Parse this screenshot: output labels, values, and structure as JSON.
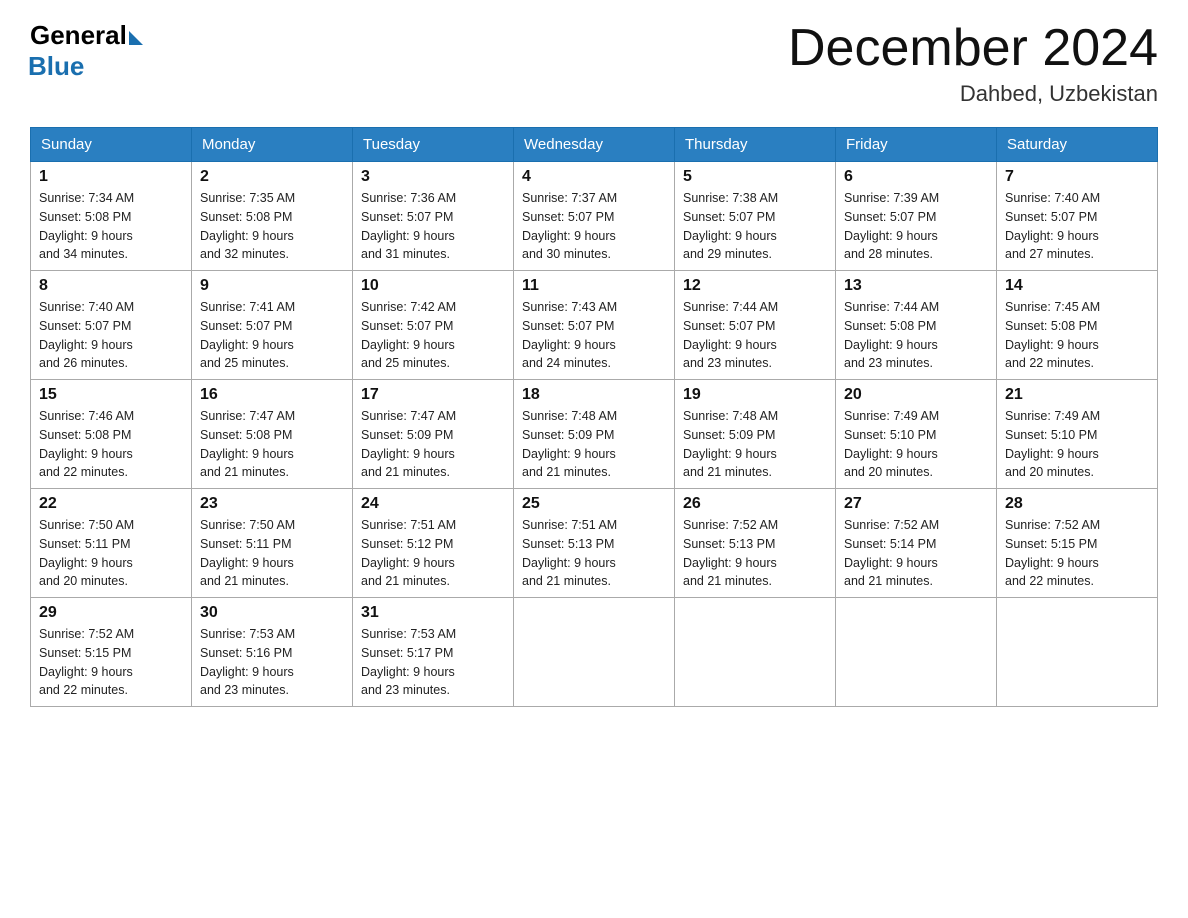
{
  "header": {
    "logo_general": "General",
    "logo_blue": "Blue",
    "month_title": "December 2024",
    "location": "Dahbed, Uzbekistan"
  },
  "columns": [
    "Sunday",
    "Monday",
    "Tuesday",
    "Wednesday",
    "Thursday",
    "Friday",
    "Saturday"
  ],
  "weeks": [
    [
      {
        "day": "1",
        "sunrise": "7:34 AM",
        "sunset": "5:08 PM",
        "daylight": "9 hours and 34 minutes."
      },
      {
        "day": "2",
        "sunrise": "7:35 AM",
        "sunset": "5:08 PM",
        "daylight": "9 hours and 32 minutes."
      },
      {
        "day": "3",
        "sunrise": "7:36 AM",
        "sunset": "5:07 PM",
        "daylight": "9 hours and 31 minutes."
      },
      {
        "day": "4",
        "sunrise": "7:37 AM",
        "sunset": "5:07 PM",
        "daylight": "9 hours and 30 minutes."
      },
      {
        "day": "5",
        "sunrise": "7:38 AM",
        "sunset": "5:07 PM",
        "daylight": "9 hours and 29 minutes."
      },
      {
        "day": "6",
        "sunrise": "7:39 AM",
        "sunset": "5:07 PM",
        "daylight": "9 hours and 28 minutes."
      },
      {
        "day": "7",
        "sunrise": "7:40 AM",
        "sunset": "5:07 PM",
        "daylight": "9 hours and 27 minutes."
      }
    ],
    [
      {
        "day": "8",
        "sunrise": "7:40 AM",
        "sunset": "5:07 PM",
        "daylight": "9 hours and 26 minutes."
      },
      {
        "day": "9",
        "sunrise": "7:41 AM",
        "sunset": "5:07 PM",
        "daylight": "9 hours and 25 minutes."
      },
      {
        "day": "10",
        "sunrise": "7:42 AM",
        "sunset": "5:07 PM",
        "daylight": "9 hours and 25 minutes."
      },
      {
        "day": "11",
        "sunrise": "7:43 AM",
        "sunset": "5:07 PM",
        "daylight": "9 hours and 24 minutes."
      },
      {
        "day": "12",
        "sunrise": "7:44 AM",
        "sunset": "5:07 PM",
        "daylight": "9 hours and 23 minutes."
      },
      {
        "day": "13",
        "sunrise": "7:44 AM",
        "sunset": "5:08 PM",
        "daylight": "9 hours and 23 minutes."
      },
      {
        "day": "14",
        "sunrise": "7:45 AM",
        "sunset": "5:08 PM",
        "daylight": "9 hours and 22 minutes."
      }
    ],
    [
      {
        "day": "15",
        "sunrise": "7:46 AM",
        "sunset": "5:08 PM",
        "daylight": "9 hours and 22 minutes."
      },
      {
        "day": "16",
        "sunrise": "7:47 AM",
        "sunset": "5:08 PM",
        "daylight": "9 hours and 21 minutes."
      },
      {
        "day": "17",
        "sunrise": "7:47 AM",
        "sunset": "5:09 PM",
        "daylight": "9 hours and 21 minutes."
      },
      {
        "day": "18",
        "sunrise": "7:48 AM",
        "sunset": "5:09 PM",
        "daylight": "9 hours and 21 minutes."
      },
      {
        "day": "19",
        "sunrise": "7:48 AM",
        "sunset": "5:09 PM",
        "daylight": "9 hours and 21 minutes."
      },
      {
        "day": "20",
        "sunrise": "7:49 AM",
        "sunset": "5:10 PM",
        "daylight": "9 hours and 20 minutes."
      },
      {
        "day": "21",
        "sunrise": "7:49 AM",
        "sunset": "5:10 PM",
        "daylight": "9 hours and 20 minutes."
      }
    ],
    [
      {
        "day": "22",
        "sunrise": "7:50 AM",
        "sunset": "5:11 PM",
        "daylight": "9 hours and 20 minutes."
      },
      {
        "day": "23",
        "sunrise": "7:50 AM",
        "sunset": "5:11 PM",
        "daylight": "9 hours and 21 minutes."
      },
      {
        "day": "24",
        "sunrise": "7:51 AM",
        "sunset": "5:12 PM",
        "daylight": "9 hours and 21 minutes."
      },
      {
        "day": "25",
        "sunrise": "7:51 AM",
        "sunset": "5:13 PM",
        "daylight": "9 hours and 21 minutes."
      },
      {
        "day": "26",
        "sunrise": "7:52 AM",
        "sunset": "5:13 PM",
        "daylight": "9 hours and 21 minutes."
      },
      {
        "day": "27",
        "sunrise": "7:52 AM",
        "sunset": "5:14 PM",
        "daylight": "9 hours and 21 minutes."
      },
      {
        "day": "28",
        "sunrise": "7:52 AM",
        "sunset": "5:15 PM",
        "daylight": "9 hours and 22 minutes."
      }
    ],
    [
      {
        "day": "29",
        "sunrise": "7:52 AM",
        "sunset": "5:15 PM",
        "daylight": "9 hours and 22 minutes."
      },
      {
        "day": "30",
        "sunrise": "7:53 AM",
        "sunset": "5:16 PM",
        "daylight": "9 hours and 23 minutes."
      },
      {
        "day": "31",
        "sunrise": "7:53 AM",
        "sunset": "5:17 PM",
        "daylight": "9 hours and 23 minutes."
      },
      null,
      null,
      null,
      null
    ]
  ]
}
